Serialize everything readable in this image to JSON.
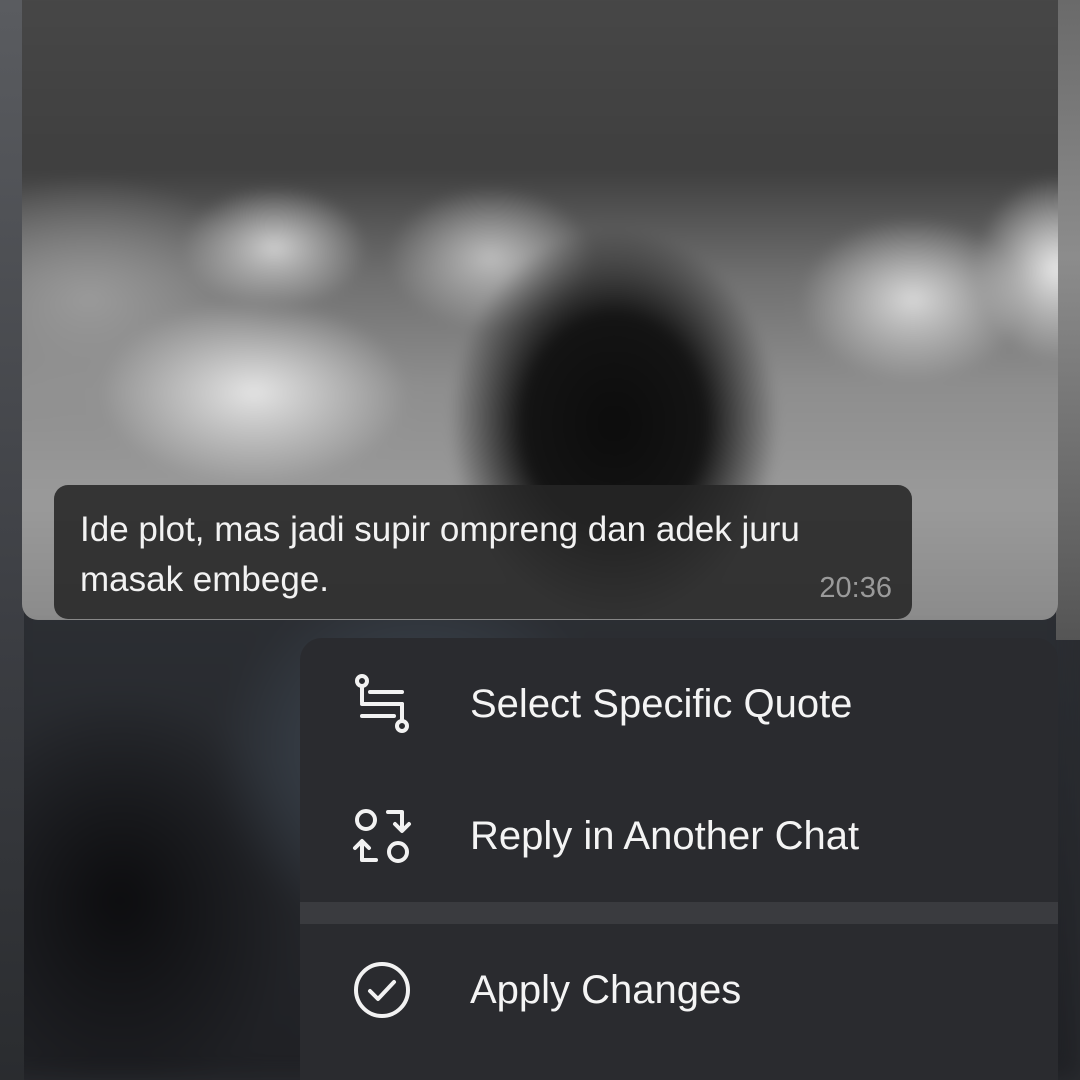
{
  "message": {
    "caption": "Ide plot, mas jadi supir ompreng dan adek juru masak embege.",
    "time": "20:36"
  },
  "context_menu": {
    "items": [
      {
        "label": "Select Specific Quote",
        "icon": "quote-select-icon"
      },
      {
        "label": "Reply in Another Chat",
        "icon": "reply-switch-icon"
      },
      {
        "label": "Apply Changes",
        "icon": "check-circle-icon"
      }
    ]
  },
  "colors": {
    "menu_background": "#2a2b2f",
    "menu_divider": "#3a3b3f",
    "caption_background": "#262626",
    "text_primary": "#f4f4f4",
    "text_secondary": "#9a9a9a"
  }
}
